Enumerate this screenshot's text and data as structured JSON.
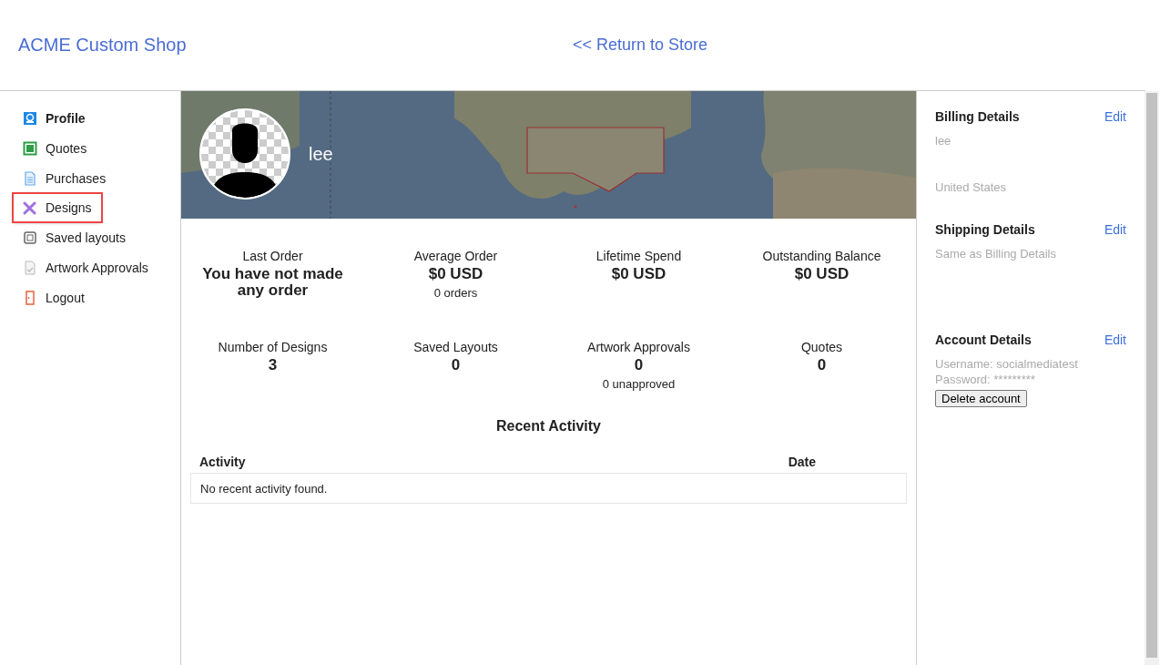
{
  "header": {
    "shop_name": "ACME Custom Shop",
    "return_link": "<< Return to Store"
  },
  "sidebar": {
    "items": [
      {
        "label": "Profile",
        "selected": false,
        "bold": true
      },
      {
        "label": "Quotes",
        "selected": false,
        "bold": false
      },
      {
        "label": "Purchases",
        "selected": false,
        "bold": false
      },
      {
        "label": "Designs",
        "selected": true,
        "bold": false
      },
      {
        "label": "Saved layouts",
        "selected": false,
        "bold": false
      },
      {
        "label": "Artwork Approvals",
        "selected": false,
        "bold": false
      },
      {
        "label": "Logout",
        "selected": false,
        "bold": false
      }
    ]
  },
  "profile": {
    "username": "lee"
  },
  "stats": [
    {
      "label": "Last Order",
      "value": "You have not made any order"
    },
    {
      "label": "Average Order",
      "value": "$0 USD",
      "sub": "0 orders"
    },
    {
      "label": "Lifetime Spend",
      "value": "$0 USD"
    },
    {
      "label": "Outstanding Balance",
      "value": "$0 USD"
    },
    {
      "label": "Number of Designs",
      "value": "3"
    },
    {
      "label": "Saved Layouts",
      "value": "0"
    },
    {
      "label": "Artwork Approvals",
      "value": "0",
      "sub": "0 unapproved"
    },
    {
      "label": "Quotes",
      "value": "0"
    }
  ],
  "recent_activity": {
    "title": "Recent Activity",
    "columns": [
      "Activity",
      "Date"
    ],
    "empty_message": "No recent activity found."
  },
  "details": [
    {
      "title": "Billing Details",
      "edit": "Edit",
      "lines": [
        "lee",
        "United States"
      ]
    },
    {
      "title": "Shipping Details",
      "edit": "Edit",
      "lines": [
        "Same as Billing Details"
      ]
    },
    {
      "title": "Account Details",
      "edit": "Edit",
      "lines": [
        "Username: socialmediatest",
        "Password: *********"
      ],
      "button": "Delete account"
    }
  ]
}
